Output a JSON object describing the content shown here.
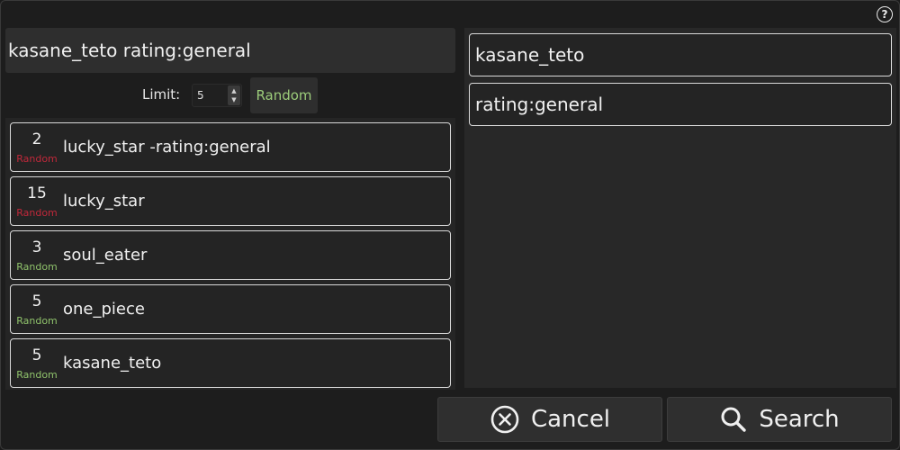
{
  "help": {
    "icon": "help-icon",
    "glyph": "?"
  },
  "query": {
    "value": "kasane_teto rating:general"
  },
  "limit": {
    "label": "Limit:",
    "value": "5"
  },
  "random_button": {
    "label": "Random"
  },
  "history": [
    {
      "count": "2",
      "random_label": "Random",
      "random_color": "#c0283a",
      "label": "lucky_star -rating:general"
    },
    {
      "count": "15",
      "random_label": "Random",
      "random_color": "#c0283a",
      "label": "lucky_star"
    },
    {
      "count": "3",
      "random_label": "Random",
      "random_color": "#8fc26b",
      "label": "soul_eater"
    },
    {
      "count": "5",
      "random_label": "Random",
      "random_color": "#8fc26b",
      "label": "one_piece"
    },
    {
      "count": "5",
      "random_label": "Random",
      "random_color": "#8fc26b",
      "label": "kasane_teto"
    }
  ],
  "tags": [
    {
      "label": "kasane_teto"
    },
    {
      "label": "rating:general"
    }
  ],
  "buttons": {
    "cancel": {
      "label": "Cancel",
      "icon": "cancel-circle-icon"
    },
    "search": {
      "label": "Search",
      "icon": "search-icon"
    }
  }
}
